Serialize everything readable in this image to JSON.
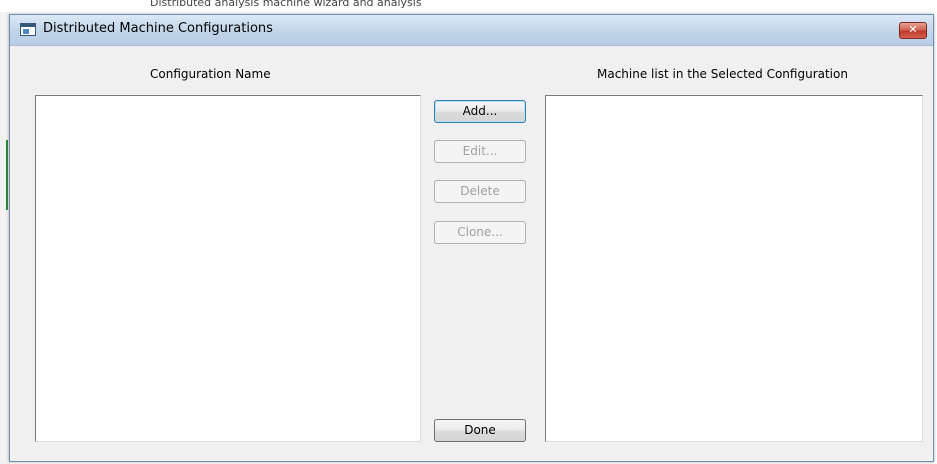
{
  "background": {
    "behind_text": "Distributed analysis machine wizard and analysis"
  },
  "dialog": {
    "title": "Distributed Machine Configurations",
    "close_label": "✕"
  },
  "left_panel": {
    "header": "Configuration Name",
    "items": []
  },
  "right_panel": {
    "header": "Machine list in the Selected Configuration",
    "items": []
  },
  "buttons": {
    "add": "Add...",
    "edit": "Edit...",
    "delete": "Delete",
    "clone": "Clone...",
    "done": "Done"
  },
  "states": {
    "add_enabled": true,
    "edit_enabled": false,
    "delete_enabled": false,
    "clone_enabled": false,
    "done_enabled": true
  },
  "colors": {
    "dialog_bg": "#f0f0f0",
    "titlebar": "#c3d6ea",
    "close_button": "#c0392b",
    "disabled_text": "#a0a0a0"
  }
}
